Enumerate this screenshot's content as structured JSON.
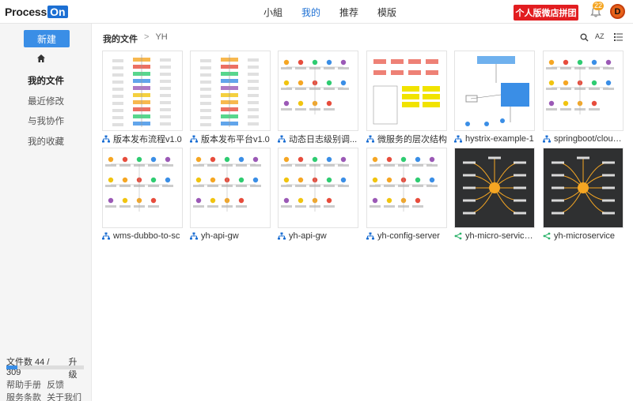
{
  "app": {
    "logo_text": "Process",
    "logo_box": "On"
  },
  "nav": {
    "items": [
      {
        "label": "小組",
        "active": false
      },
      {
        "label": "我的",
        "active": true
      },
      {
        "label": "推荐",
        "active": false
      },
      {
        "label": "模版",
        "active": false
      }
    ]
  },
  "header": {
    "promo_label": "个人版微店拼团",
    "notification_count": "22",
    "avatar_letter": "D"
  },
  "sidebar": {
    "new_button": "新建",
    "items": [
      {
        "label": "我的文件",
        "active": true
      },
      {
        "label": "最近修改",
        "active": false
      },
      {
        "label": "与我协作",
        "active": false
      },
      {
        "label": "我的收藏",
        "active": false
      }
    ],
    "quota_label": "文件数 44 / 309",
    "quota_upgrade": "升级",
    "quota_fraction": 0.142,
    "footer_row1": [
      "帮助手册",
      "反馈"
    ],
    "footer_row2": [
      "服务条款",
      "关于我们"
    ]
  },
  "breadcrumb": {
    "root": "我的文件",
    "separator": ">",
    "current": "YH"
  },
  "toolbar": {
    "sort_label": "AZ"
  },
  "files": [
    {
      "name": "版本发布流程v1.0",
      "type": "flowchart",
      "dark": false
    },
    {
      "name": "版本发布平台v1.0",
      "type": "flowchart",
      "dark": false
    },
    {
      "name": "动态日志级别调...",
      "type": "flowchart",
      "dark": false
    },
    {
      "name": "微服务的层次结构",
      "type": "flowchart",
      "dark": false
    },
    {
      "name": "hystrix-example-1",
      "type": "flowchart",
      "dark": false
    },
    {
      "name": "springboot/cloud...",
      "type": "flowchart",
      "dark": false
    },
    {
      "name": "wms-dubbo-to-sc",
      "type": "flowchart",
      "dark": false
    },
    {
      "name": "yh-api-gw",
      "type": "flowchart",
      "dark": false
    },
    {
      "name": "yh-api-gw",
      "type": "flowchart",
      "dark": false
    },
    {
      "name": "yh-config-server",
      "type": "flowchart",
      "dark": false
    },
    {
      "name": "yh-micro-service-2",
      "type": "mindmap",
      "dark": true
    },
    {
      "name": "yh-microservice",
      "type": "mindmap",
      "dark": true
    }
  ],
  "colors": {
    "accent": "#1c6fd3",
    "promo": "#e21d20",
    "new_button": "#3a8ee6",
    "mindmap_icon": "#2db36b"
  }
}
